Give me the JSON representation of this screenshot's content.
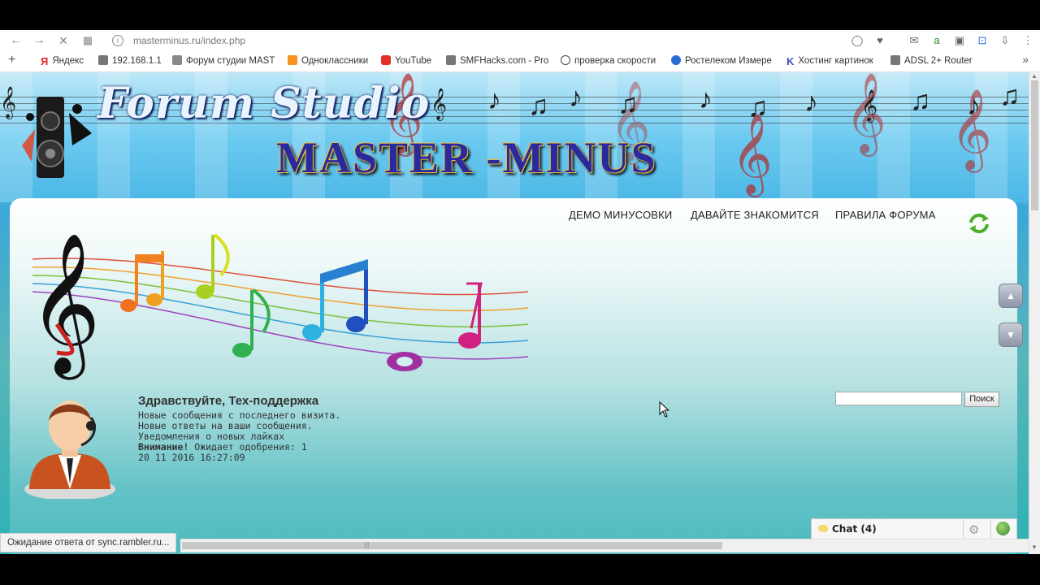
{
  "browser": {
    "url": "masterminus.ru/index.php",
    "nav_icons": {
      "back": "back-arrow-icon",
      "forward": "forward-arrow-icon",
      "stop": "close-icon",
      "apps": "grid-icon"
    }
  },
  "bookmarks": [
    {
      "label": "Яндекс",
      "color": "#e8232a"
    },
    {
      "label": "192.168.1.1",
      "color": "#555555"
    },
    {
      "label": "Форум студии MAST",
      "color": "#555555"
    },
    {
      "label": "Одноклассники",
      "color": "#f7931e"
    },
    {
      "label": "YouTube",
      "color": "#e52d27"
    },
    {
      "label": "SMFHacks.com - Proc",
      "color": "#555555"
    },
    {
      "label": "проверка скорости",
      "color": "#444444"
    },
    {
      "label": "Ростелеком Измере",
      "color": "#2a6bd1"
    },
    {
      "label": "Хостинг картинок",
      "color": "#3a4fb0"
    },
    {
      "label": "ADSL 2+ Router",
      "color": "#555555"
    }
  ],
  "banner": {
    "forum_title": "Forum Studio",
    "brand_title": "MASTER -MINUS"
  },
  "nav": {
    "demo": "ДЕМО МИНУСОВКИ",
    "meet": "ДАВАЙТЕ ЗНАКОМИТСЯ",
    "rules": "ПРАВИЛА ФОРУМА"
  },
  "user": {
    "greeting": "Здравствуйте, Тех-поддержка",
    "line1": "Новые сообщения с последнего визита.",
    "line2": "Новые ответы на ваши сообщения.",
    "line3": "Уведомления о новых лайках",
    "attention_label": "Внимание!",
    "attention_text": " Ожидает одобрения: 1",
    "datetime": "20 11 2016 16:27:09"
  },
  "search": {
    "value": "",
    "button": "Поиск"
  },
  "status": "Ожидание ответа от sync.rambler.ru...",
  "chat": {
    "label": "Chat (4)"
  }
}
